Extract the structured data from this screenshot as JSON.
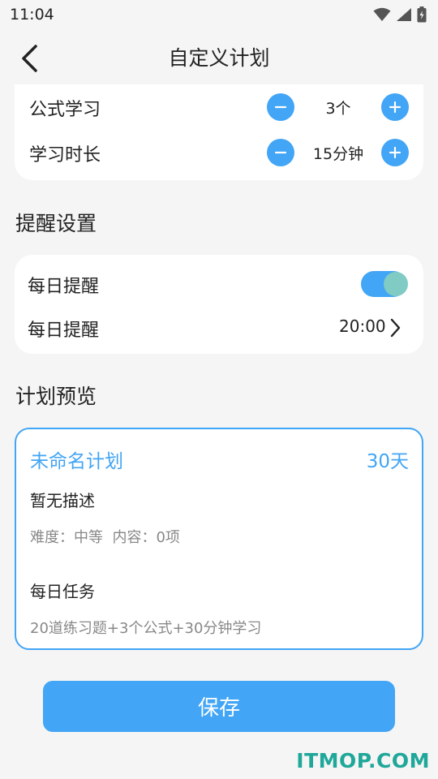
{
  "status_bar": {
    "time": "11:04"
  },
  "header": {
    "title": "自定义计划"
  },
  "study": {
    "rows": [
      {
        "label": "公式学习",
        "value": "3个"
      },
      {
        "label": "学习时长",
        "value": "15分钟"
      }
    ]
  },
  "reminder_section": {
    "title": "提醒设置",
    "daily_toggle_label": "每日提醒",
    "daily_toggle_on": true,
    "daily_time_label": "每日提醒",
    "daily_time_value": "20:00"
  },
  "preview_section": {
    "title": "计划预览",
    "plan_name": "未命名计划",
    "plan_days": "30天",
    "description": "暂无描述",
    "meta": "难度：中等  内容：0项",
    "daily_title": "每日任务",
    "daily_tasks": "20道练习题+3个公式+30分钟学习"
  },
  "save_label": "保存",
  "watermark": "ITMOP.COM",
  "colors": {
    "accent": "#42a5f5",
    "toggle_knob": "#80cbc4",
    "background": "#f5f5f5"
  },
  "icons": [
    "wifi-icon",
    "signal-icon",
    "battery-icon",
    "back-arrow-icon",
    "minus-icon",
    "plus-icon",
    "chevron-right-icon"
  ]
}
